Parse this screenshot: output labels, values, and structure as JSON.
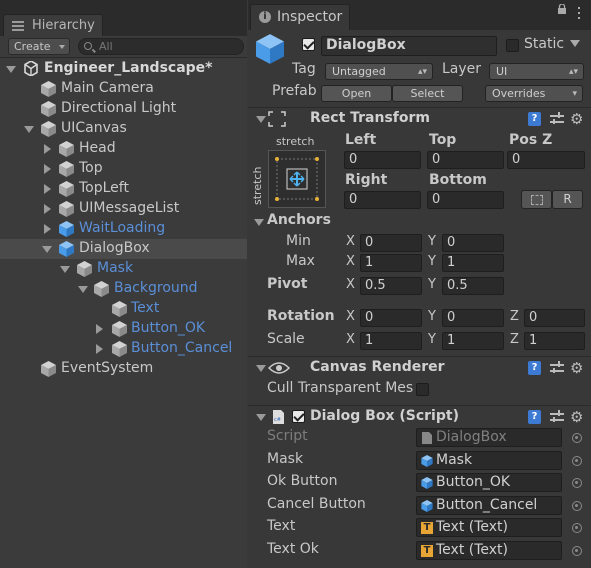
{
  "hierarchy": {
    "tab_label": "Hierarchy",
    "create_label": "Create",
    "search_placeholder": "All",
    "scene_name": "Engineer_Landscape*",
    "items": [
      {
        "label": "Main Camera"
      },
      {
        "label": "Directional Light"
      },
      {
        "label": "UICanvas"
      },
      {
        "label": "Head"
      },
      {
        "label": "Top"
      },
      {
        "label": "TopLeft"
      },
      {
        "label": "UIMessageList"
      },
      {
        "label": "WaitLoading"
      },
      {
        "label": "DialogBox"
      },
      {
        "label": "Mask"
      },
      {
        "label": "Background"
      },
      {
        "label": "Text"
      },
      {
        "label": "Button_OK"
      },
      {
        "label": "Button_Cancel"
      },
      {
        "label": "EventSystem"
      }
    ],
    "selected_item": "DialogBox"
  },
  "inspector": {
    "tab_label": "Inspector",
    "object_name": "DialogBox",
    "static_label": "Static",
    "tag_label": "Tag",
    "tag_value": "Untagged",
    "layer_label": "Layer",
    "layer_value": "UI",
    "prefab_label": "Prefab",
    "open_label": "Open",
    "select_label": "Select",
    "overrides_label": "Overrides"
  },
  "rect_transform": {
    "title": "Rect Transform",
    "anchor_h": "stretch",
    "anchor_v": "stretch",
    "left_label": "Left",
    "left": "0",
    "top_label": "Top",
    "top": "0",
    "posz_label": "Pos Z",
    "posz": "0",
    "right_label": "Right",
    "right": "0",
    "bottom_label": "Bottom",
    "bottom": "0",
    "r_button": "R",
    "anchors_label": "Anchors",
    "min_label": "Min",
    "min_x": "0",
    "min_y": "0",
    "max_label": "Max",
    "max_x": "1",
    "max_y": "1",
    "pivot_label": "Pivot",
    "pivot_x": "0.5",
    "pivot_y": "0.5",
    "rotation_label": "Rotation",
    "rot_x": "0",
    "rot_y": "0",
    "rot_z": "0",
    "scale_label": "Scale",
    "scale_x": "1",
    "scale_y": "1",
    "scale_z": "1",
    "axis_x": "X",
    "axis_y": "Y",
    "axis_z": "Z"
  },
  "canvas_renderer": {
    "title": "Canvas Renderer",
    "cull_label": "Cull Transparent Mes"
  },
  "dialog_box_script": {
    "title": "Dialog Box (Script)",
    "fields": [
      {
        "label": "Script",
        "value": "DialogBox"
      },
      {
        "label": "Mask",
        "value": "Mask"
      },
      {
        "label": "Ok Button",
        "value": "Button_OK"
      },
      {
        "label": "Cancel Button",
        "value": "Button_Cancel"
      },
      {
        "label": "Text",
        "value": "Text (Text)"
      },
      {
        "label": "Text Ok",
        "value": "Text (Text)"
      }
    ]
  },
  "colors": {
    "panel_bg": "#383838",
    "tab_bar": "#2b2b2b",
    "selected_row": "#4a4a4a",
    "prefab_blue_text": "#5a8fd8",
    "prefab_cube": "#4a9be8"
  }
}
